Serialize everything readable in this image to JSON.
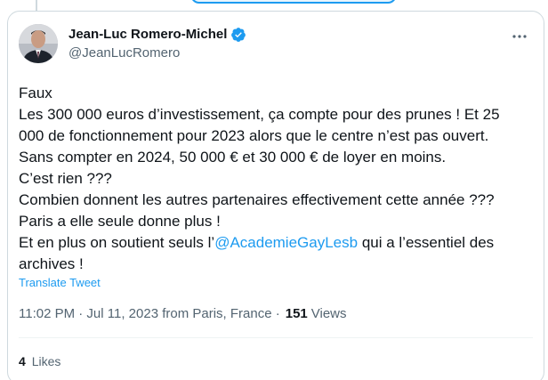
{
  "author": {
    "display_name": "Jean-Luc Romero-Michel",
    "handle": "@JeanLucRomero",
    "verified": true
  },
  "tweet": {
    "lines": [
      "Faux",
      "Les 300 000 euros d’investissement, ça compte pour des prunes  ! Et 25 000 de fonctionnement pour 2023 alors que le centre n’est pas ouvert.",
      "Sans compter en 2024, 50 000 € et 30 000 € de loyer en moins.",
      "C’est rien ???",
      "Combien donnent les autres partenaires effectivement cette année ???",
      "Paris a elle seule donne plus !"
    ],
    "last_line_prefix": "Et en plus on soutient seuls l’",
    "mention": "@AcademieGayLesb",
    "last_line_suffix": " qui a l’essentiel des archives !"
  },
  "translate_label": "Translate Tweet",
  "meta": {
    "timestamp": "11:02 PM · Jul 11, 2023 from Paris, France ·",
    "views_count": "151",
    "views_label": "Views"
  },
  "engagement": {
    "likes_count": "4",
    "likes_label": "Likes"
  },
  "colors": {
    "accent": "#1d9bf0",
    "text": "#0f1419",
    "secondary": "#536471",
    "border": "#cfd9de"
  },
  "icons": {
    "verified": "verified-badge-icon",
    "more": "more-options-icon"
  }
}
